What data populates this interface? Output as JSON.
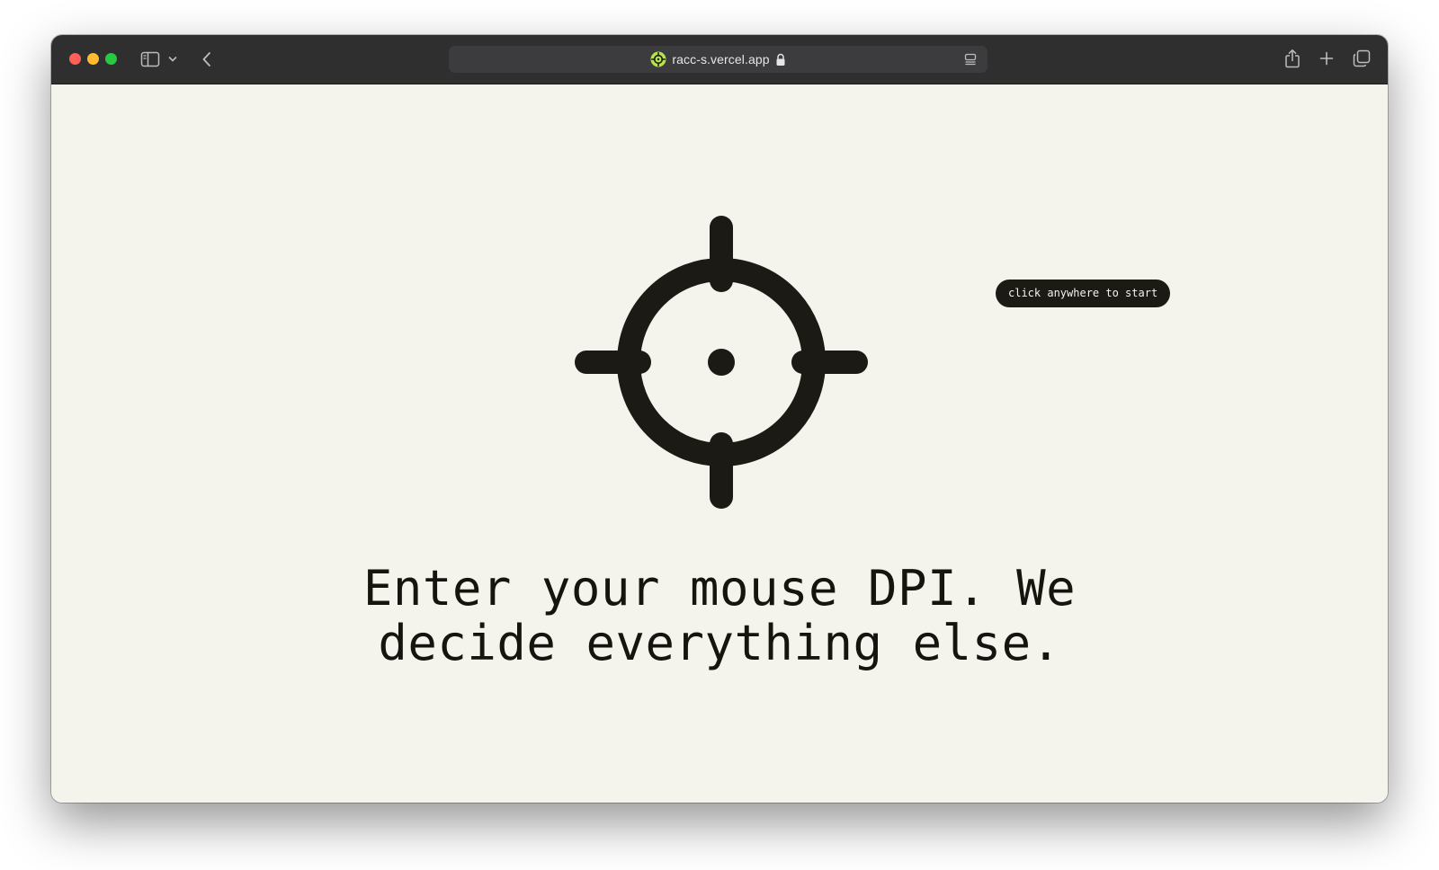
{
  "browser": {
    "url": "racc-s.vercel.app",
    "traffic_lights": [
      "close",
      "minimize",
      "zoom"
    ],
    "icons": {
      "sidebar": "sidebar-toggle-icon",
      "sidebar_menu": "chevron-down-icon",
      "back": "chevron-left-icon",
      "site": "crosshair-favicon-icon",
      "secure": "lock-icon",
      "reader": "reader-icon",
      "share": "share-icon",
      "new_tab": "plus-icon",
      "tab_overview": "tabs-icon"
    }
  },
  "page": {
    "icon": "crosshair-icon",
    "tooltip": "click anywhere to start",
    "headline_line1": "Enter your mouse DPI. We",
    "headline_line2": "decide everything else."
  },
  "colors": {
    "background": "#f4f3ec",
    "ink": "#1b1a15",
    "toolbar": "#2f2f30",
    "favicon_accent": "#b7e34a"
  }
}
